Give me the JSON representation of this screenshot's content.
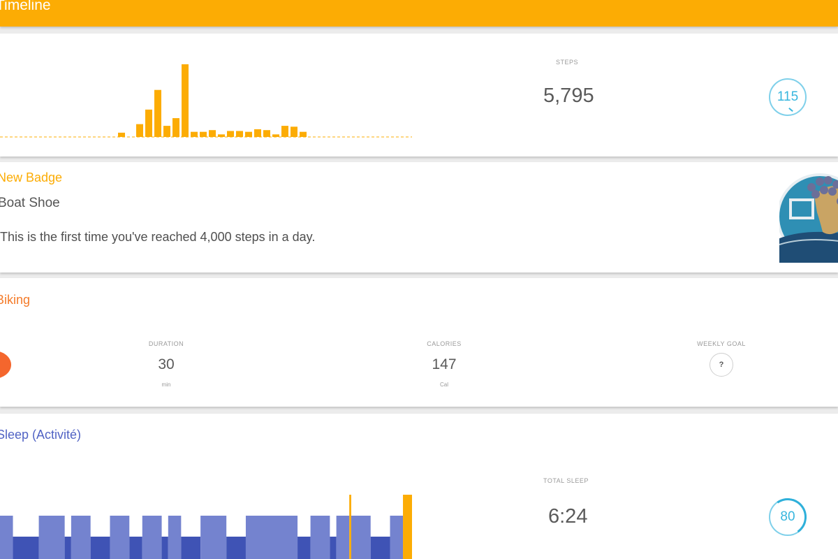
{
  "header": {
    "title": "Timeline",
    "color": "#fcac04"
  },
  "steps_card": {
    "caption": "STEPS",
    "value": "5,795",
    "ring_value": "115",
    "chart_data": {
      "type": "bar",
      "color": "#fcac04",
      "values": [
        0,
        0,
        0,
        0,
        0,
        0,
        0,
        0,
        0,
        0,
        0,
        0,
        0,
        5,
        0,
        15,
        32,
        55,
        13,
        22,
        85,
        6,
        6,
        8,
        3,
        7,
        7,
        6,
        9,
        8,
        3,
        13,
        12,
        6,
        0,
        0,
        0,
        0,
        0,
        0,
        0,
        0,
        0
      ]
    }
  },
  "badge_card": {
    "title": "New Badge",
    "name": "Boat Shoe",
    "description": "This is the first time you've reached 4,000 steps in a day.",
    "color": "#fcac04"
  },
  "activity_card": {
    "title": "Biking",
    "color": "#f47b2a",
    "duration": {
      "caption": "DURATION",
      "value": "30",
      "unit": "min"
    },
    "calories": {
      "caption": "CALORIES",
      "value": "147",
      "unit": "Cal"
    },
    "weekly_goal": {
      "caption": "WEEKLY GOAL",
      "value": "?"
    }
  },
  "sleep_card": {
    "title": "Sleep (Activité)",
    "caption": "TOTAL SLEEP",
    "value": "6:24",
    "ring_value": "80",
    "colors": {
      "light": "#7483cf",
      "deep": "#3f53b5",
      "awake": "#fcac04"
    },
    "chart_data": {
      "type": "bar",
      "segments": [
        {
          "stage": "light",
          "duration": 2
        },
        {
          "stage": "deep",
          "duration": 4
        },
        {
          "stage": "light",
          "duration": 4
        },
        {
          "stage": "deep",
          "duration": 1
        },
        {
          "stage": "light",
          "duration": 3
        },
        {
          "stage": "deep",
          "duration": 3
        },
        {
          "stage": "light",
          "duration": 3
        },
        {
          "stage": "deep",
          "duration": 2
        },
        {
          "stage": "light",
          "duration": 3
        },
        {
          "stage": "deep",
          "duration": 1
        },
        {
          "stage": "light",
          "duration": 2
        },
        {
          "stage": "deep",
          "duration": 3
        },
        {
          "stage": "light",
          "duration": 4
        },
        {
          "stage": "deep",
          "duration": 3
        },
        {
          "stage": "light",
          "duration": 8
        },
        {
          "stage": "deep",
          "duration": 2
        },
        {
          "stage": "light",
          "duration": 3
        },
        {
          "stage": "deep",
          "duration": 1
        },
        {
          "stage": "light",
          "duration": 2
        },
        {
          "stage": "awake",
          "duration": 0.3
        },
        {
          "stage": "light",
          "duration": 3
        },
        {
          "stage": "deep",
          "duration": 3
        },
        {
          "stage": "light",
          "duration": 2
        },
        {
          "stage": "awake",
          "duration": 1.4
        }
      ]
    }
  }
}
